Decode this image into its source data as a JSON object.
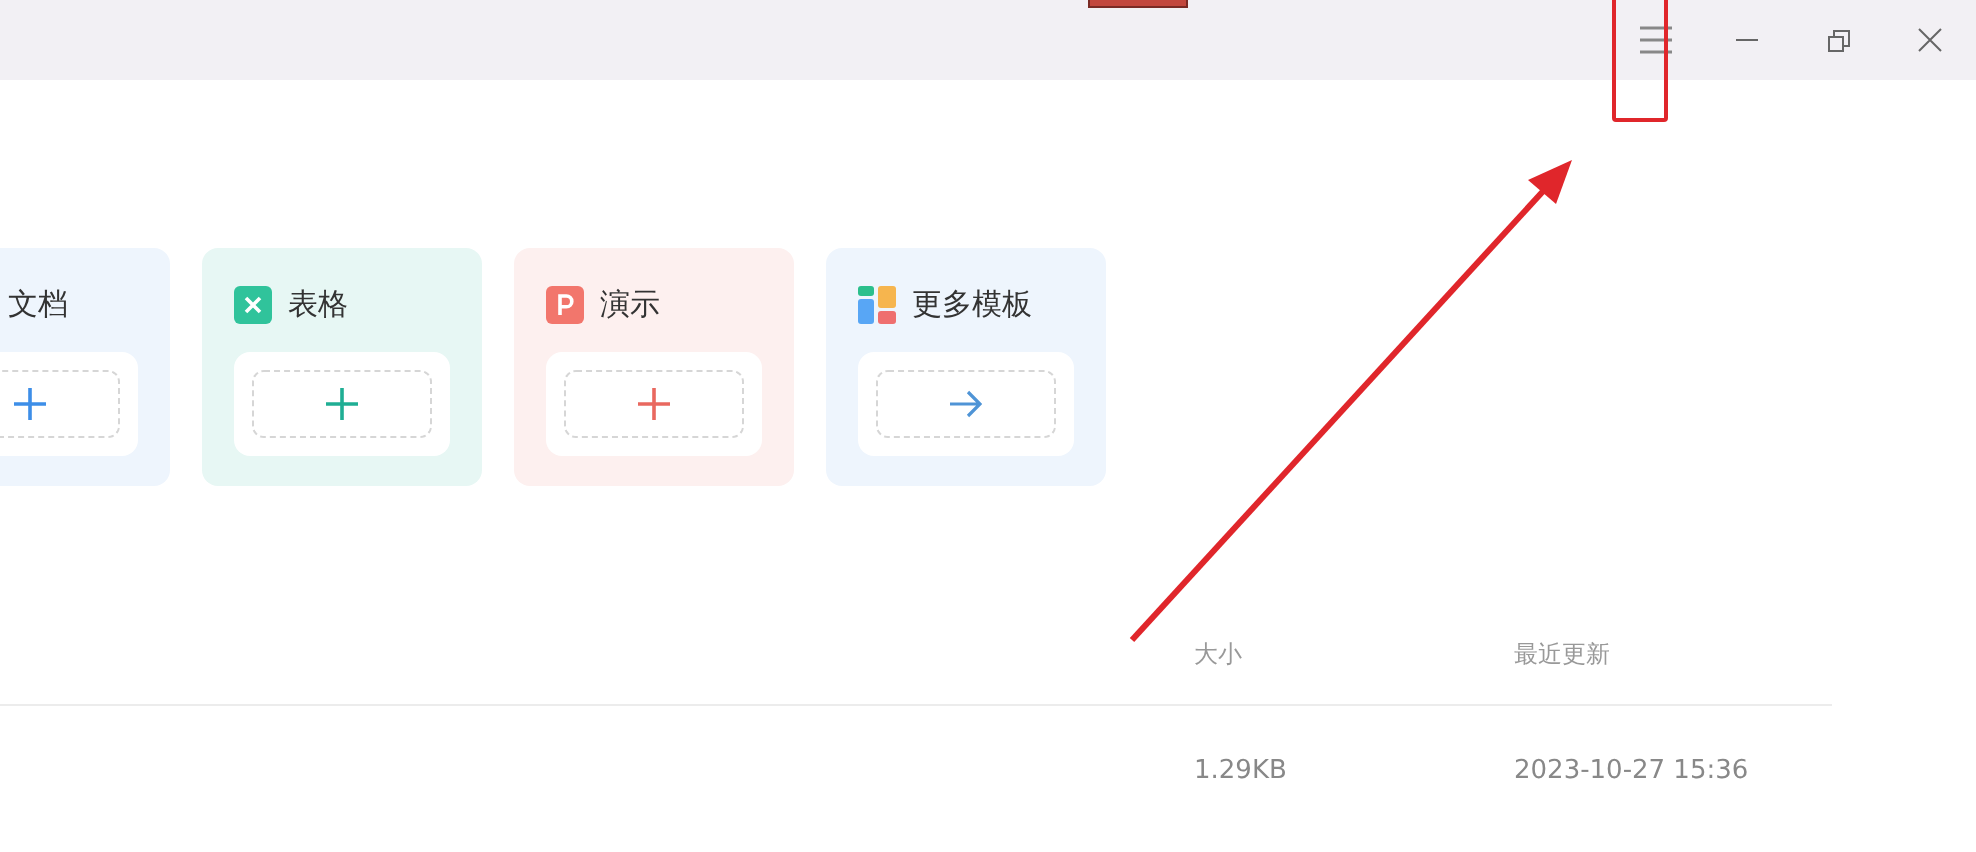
{
  "title_bar": {
    "controls": [
      {
        "kind": "menu"
      },
      {
        "kind": "minimize"
      },
      {
        "kind": "restore"
      },
      {
        "kind": "close"
      }
    ]
  },
  "new_cards": [
    {
      "kind": "doc",
      "label": "文档"
    },
    {
      "kind": "sheet",
      "label": "表格"
    },
    {
      "kind": "slides",
      "label": "演示"
    },
    {
      "kind": "templates",
      "label": "更多模板"
    }
  ],
  "file_list": {
    "columns": [
      "大小",
      "最近更新"
    ],
    "rows": [
      [
        "1.29KB",
        "2023-10-27 15:36"
      ]
    ]
  },
  "annotations": {
    "highlight_box": true,
    "arrow": true
  }
}
